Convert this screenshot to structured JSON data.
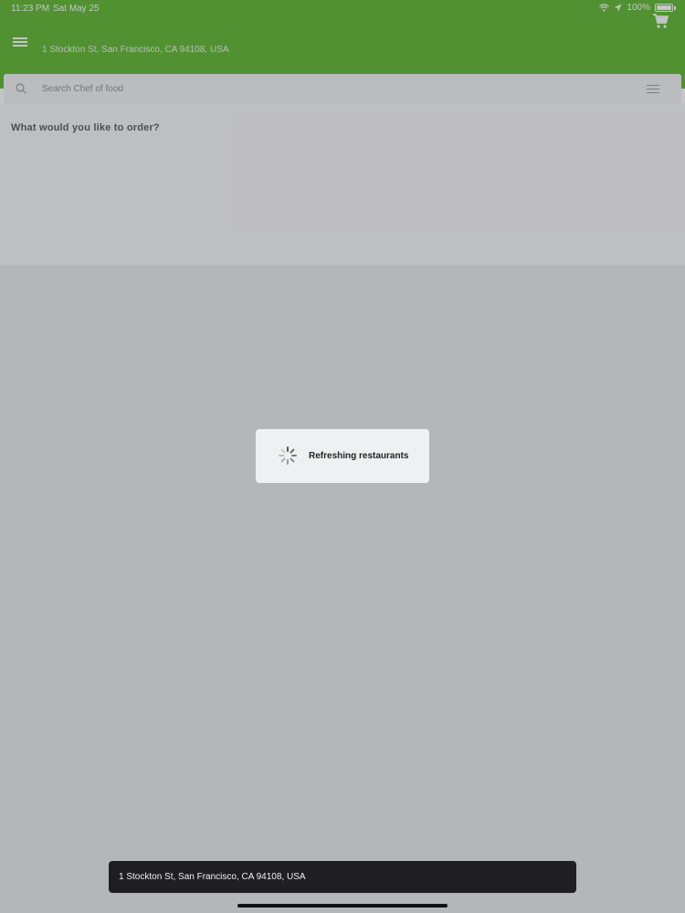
{
  "status_bar": {
    "time": "11:23 PM",
    "date": "Sat May 25",
    "battery_percent": "100%"
  },
  "header": {
    "address": "1 Stockton St, San Francisco, CA 94108, USA",
    "menu_icon": "hamburger-menu-icon",
    "cart_icon": "cart-icon"
  },
  "search": {
    "placeholder": "Search Chef of food",
    "search_icon": "search-icon",
    "filter_icon": "filter-icon"
  },
  "main": {
    "heading": "What would you like to order?"
  },
  "loading": {
    "label": "Refreshing restaurants"
  },
  "toast": {
    "text": "1 Stockton St, San Francisco, CA 94108, USA"
  },
  "colors": {
    "brand_green": "#5bb52c",
    "toast_bg": "#1f1f21"
  }
}
